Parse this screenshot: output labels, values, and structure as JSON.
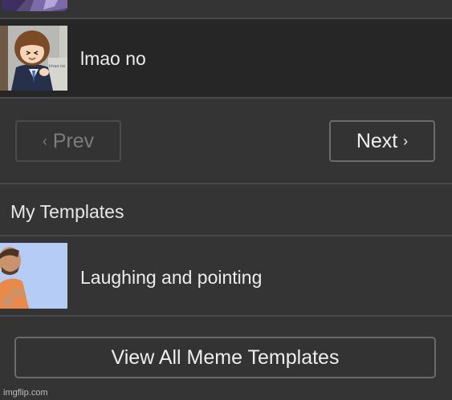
{
  "list": {
    "items": [
      {
        "label": "lmao no",
        "thumb_icon": "anime-girl-thumbnail",
        "active": true
      }
    ]
  },
  "pager": {
    "prev_label": "Prev",
    "prev_icon": "‹",
    "next_label": "Next",
    "next_icon": "›"
  },
  "my_templates": {
    "title": "My Templates",
    "items": [
      {
        "label": "Laughing and pointing",
        "thumb_icon": "laughing-man-thumbnail"
      }
    ]
  },
  "footer": {
    "view_all_label": "View All Meme Templates",
    "watermark": "imgflip.com"
  },
  "colors": {
    "background": "#343434",
    "active_row": "#262626",
    "divider": "#4a4a4a",
    "text": "#ececec",
    "disabled_text": "#7c7c7c"
  }
}
